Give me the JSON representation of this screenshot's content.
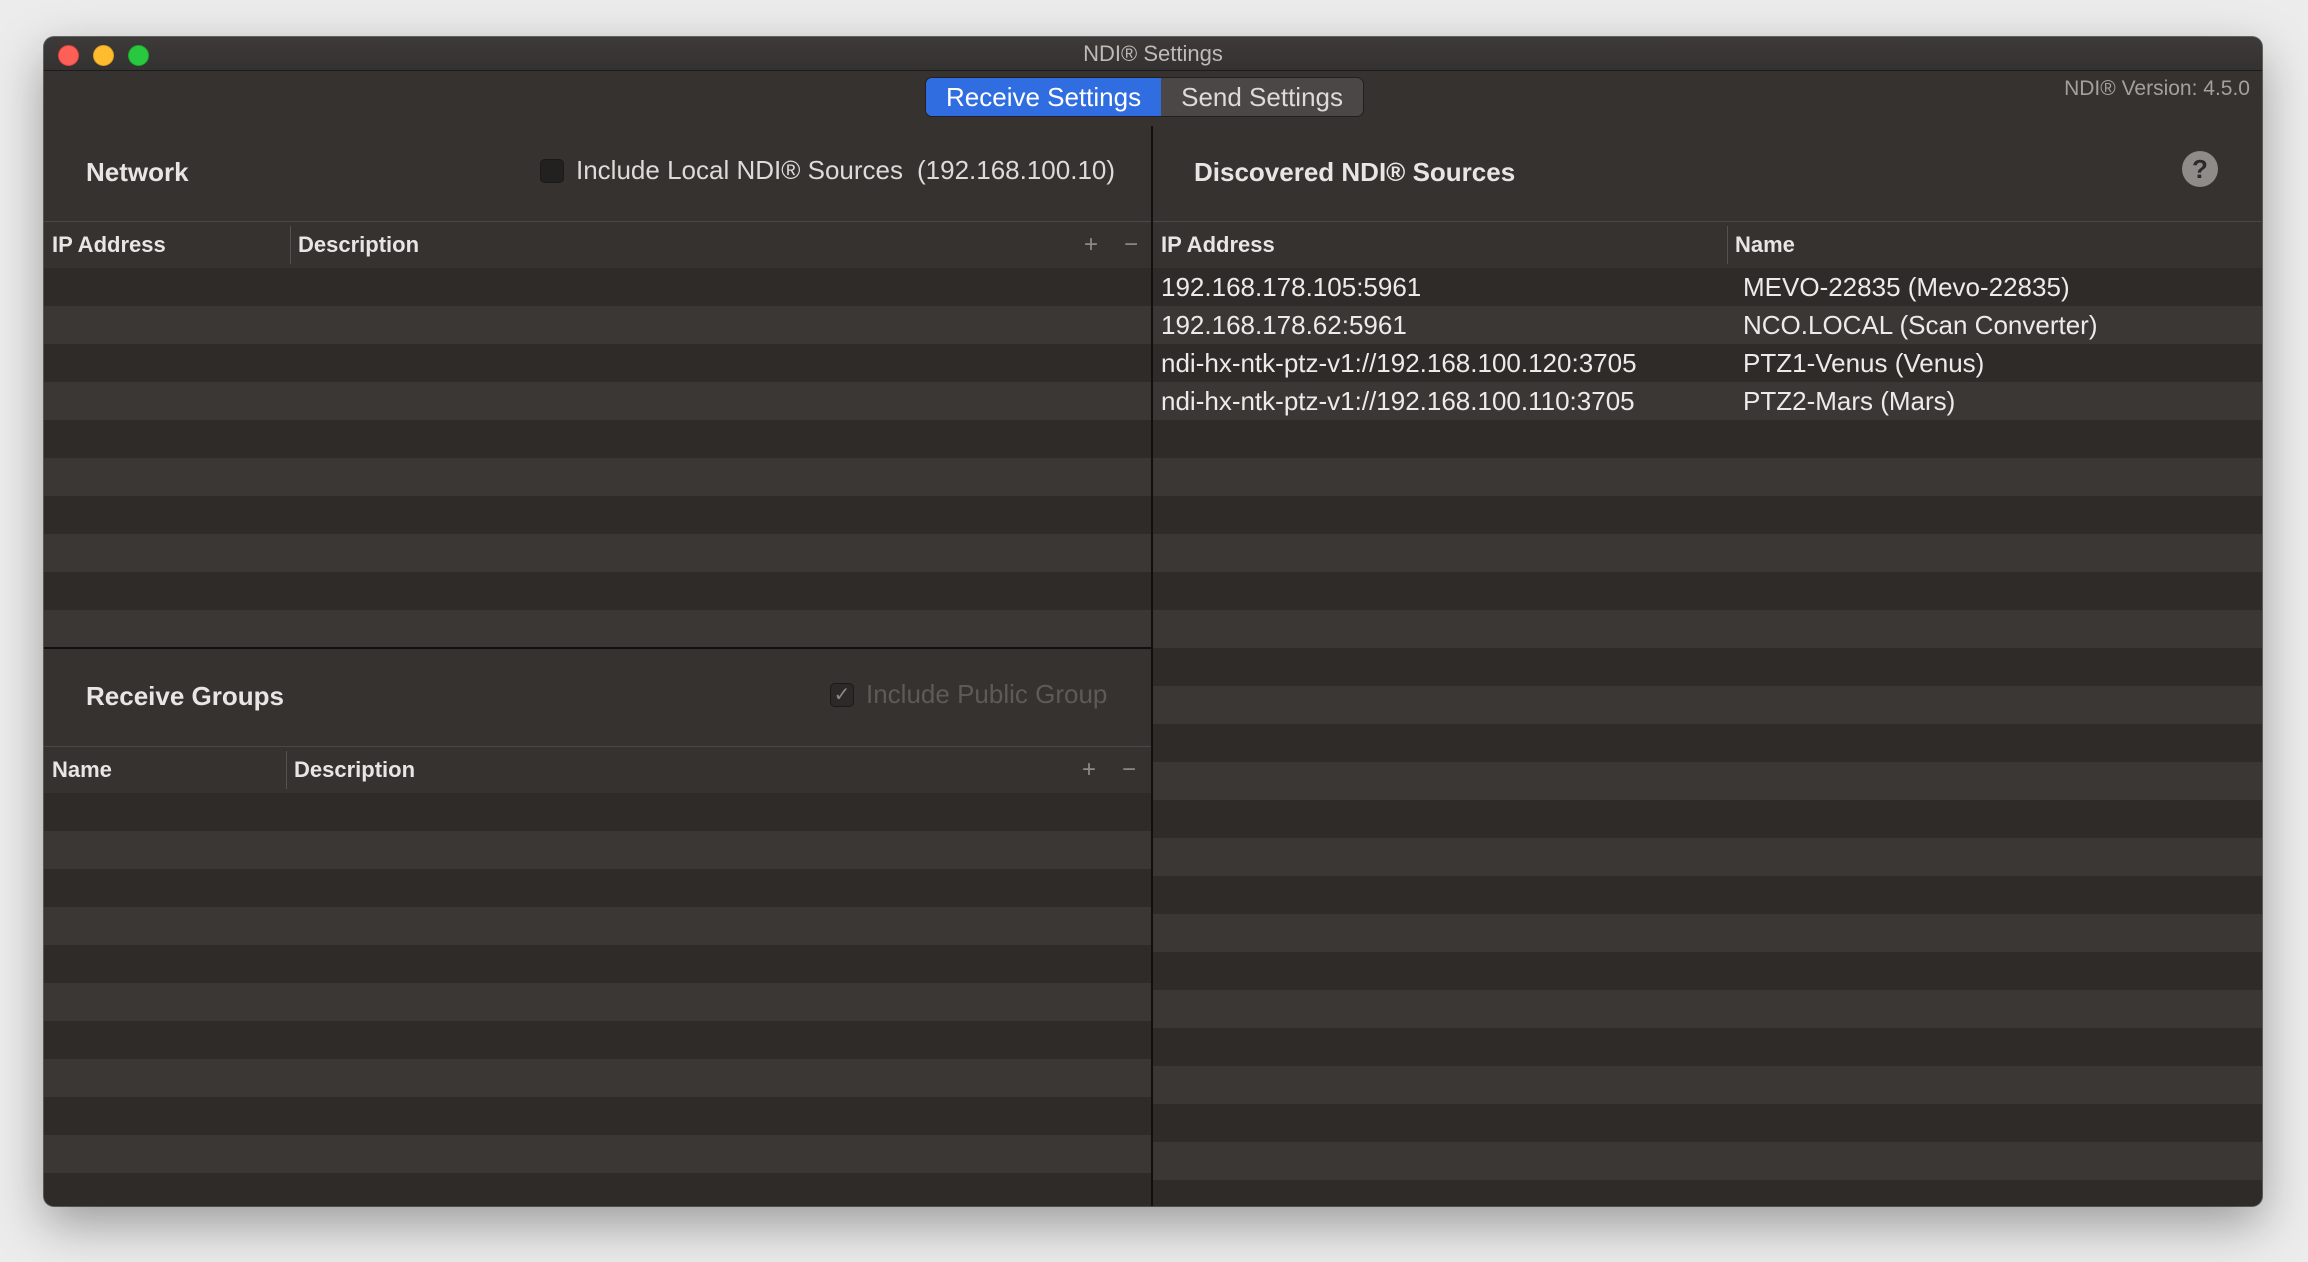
{
  "window": {
    "title": "NDI® Settings"
  },
  "tabs": [
    {
      "label": "Receive Settings",
      "active": true
    },
    {
      "label": "Send Settings",
      "active": false
    }
  ],
  "version": "NDI® Version: 4.5.0",
  "network": {
    "title": "Network",
    "include_local_label": "Include Local NDI® Sources",
    "include_local_ip": "(192.168.100.10)",
    "include_local_checked": false,
    "columns": [
      "IP Address",
      "Description"
    ],
    "add_symbol": "+",
    "remove_symbol": "−",
    "rows": []
  },
  "receive_groups": {
    "title": "Receive Groups",
    "include_public_label": "Include Public Group",
    "include_public_checked": true,
    "columns": [
      "Name",
      "Description"
    ],
    "add_symbol": "+",
    "remove_symbol": "−",
    "rows": []
  },
  "discovered": {
    "title": "Discovered NDI® Sources",
    "help_symbol": "?",
    "columns": [
      "IP Address",
      "Name"
    ],
    "rows": [
      {
        "ip": "192.168.178.105:5961",
        "name": "MEVO-22835 (Mevo-22835)"
      },
      {
        "ip": "192.168.178.62:5961",
        "name": "NCO.LOCAL (Scan Converter)"
      },
      {
        "ip": "ndi-hx-ntk-ptz-v1://192.168.100.120:3705",
        "name": "PTZ1-Venus (Venus)"
      },
      {
        "ip": "ndi-hx-ntk-ptz-v1://192.168.100.110:3705",
        "name": "PTZ2-Mars (Mars)"
      }
    ]
  }
}
